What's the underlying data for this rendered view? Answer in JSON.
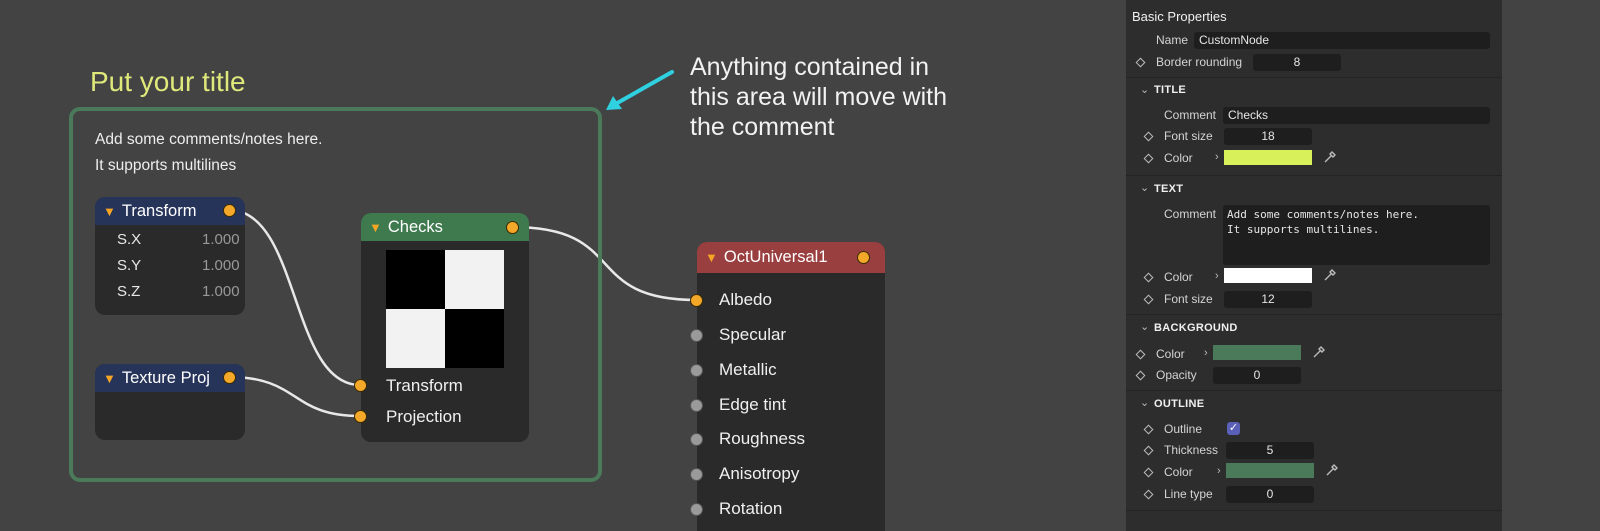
{
  "canvas": {
    "comment": {
      "title": "Put your title",
      "text": "Add some comments/notes here.\nIt supports multilines",
      "outline_color": "#4a7a5a",
      "title_color": "#dfe87a"
    },
    "annotation": "Anything contained in\nthis area will move with\nthe comment",
    "arrow_color": "#2fd0e0",
    "nodes": {
      "transform": {
        "title": "Transform",
        "header_color": "#27345a",
        "params": [
          {
            "label": "S.X",
            "value": "1.000"
          },
          {
            "label": "S.Y",
            "value": "1.000"
          },
          {
            "label": "S.Z",
            "value": "1.000"
          }
        ]
      },
      "texture_proj": {
        "title": "Texture Proj",
        "header_color": "#27345a"
      },
      "checks": {
        "title": "Checks",
        "header_color": "#3f7a4f",
        "inputs": [
          "Transform",
          "Projection"
        ]
      },
      "oct_universal": {
        "title": "OctUniversal1",
        "header_color": "#9a3f3f",
        "inputs": [
          "Albedo",
          "Specular",
          "Metallic",
          "Edge tint",
          "Roughness",
          "Anisotropy",
          "Rotation"
        ]
      }
    }
  },
  "panel": {
    "title": "Basic Properties",
    "name_label": "Name",
    "name_value": "CustomNode",
    "border_rounding_label": "Border rounding",
    "border_rounding_value": "8",
    "title_section": {
      "heading": "TITLE",
      "comment_label": "Comment",
      "comment_value": "Checks",
      "font_size_label": "Font size",
      "font_size_value": "18",
      "color_label": "Color",
      "color": "#d8f05a"
    },
    "text_section": {
      "heading": "TEXT",
      "comment_label": "Comment",
      "comment_value": "Add some comments/notes here.\nIt supports multilines.",
      "color_label": "Color",
      "color": "#ffffff",
      "font_size_label": "Font size",
      "font_size_value": "12"
    },
    "background_section": {
      "heading": "BACKGROUND",
      "color_label": "Color",
      "color": "#4a7a5a",
      "opacity_label": "Opacity",
      "opacity_value": "0"
    },
    "outline_section": {
      "heading": "OUTLINE",
      "outline_label": "Outline",
      "outline_checked": true,
      "thickness_label": "Thickness",
      "thickness_value": "5",
      "color_label": "Color",
      "color": "#4a7a5a",
      "line_type_label": "Line type",
      "line_type_value": "0"
    }
  }
}
